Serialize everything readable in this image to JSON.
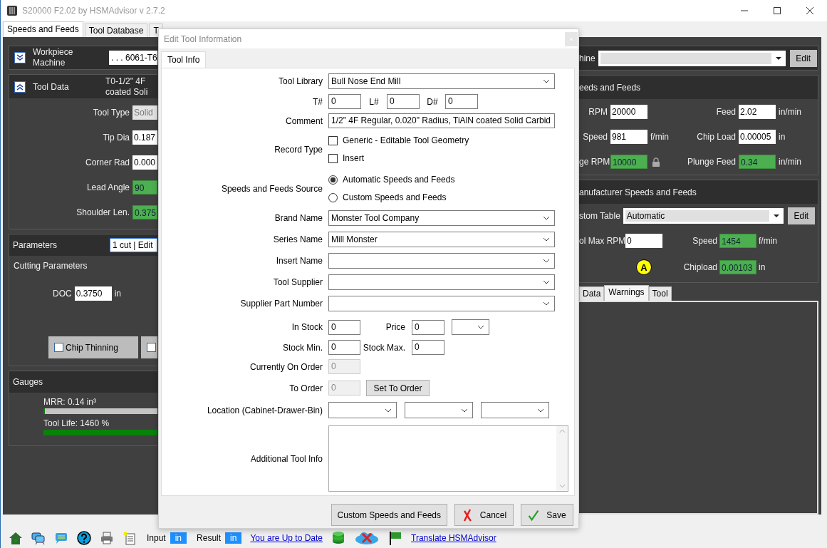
{
  "window": {
    "title": "S20000 F2.02 by HSMAdvisor v 2.7.2"
  },
  "main_tabs": [
    {
      "label": "Speeds and Feeds",
      "selected": true
    },
    {
      "label": "Tool Database",
      "selected": false
    },
    {
      "label": "T",
      "selected": false
    }
  ],
  "workpiece": {
    "label_lines": [
      "Workpiece",
      "Machine"
    ],
    "value": ". . . 6061-T6",
    "expanded": false
  },
  "tool_data": {
    "title": "Tool Data",
    "expanded": true,
    "summary": [
      "T0-1/2\" 4F",
      "coated Soli"
    ],
    "fields": [
      {
        "label": "Tool Type",
        "value": "Solid",
        "kind": "select"
      },
      {
        "label": "Tip Dia",
        "value": "0.187",
        "kind": "input"
      },
      {
        "label": "Corner Rad",
        "value": "0.000",
        "kind": "input"
      },
      {
        "label": "Lead Angle",
        "value": "90",
        "kind": "computed"
      },
      {
        "label": "Shoulder Len.",
        "value": "0.375",
        "kind": "computed"
      }
    ]
  },
  "parameters": {
    "title": "Parameters",
    "value": "1 cut | Edit",
    "subtitle": "Cutting Parameters",
    "doc": {
      "label": "DOC",
      "value": "0.3750",
      "unit": "in"
    },
    "options": [
      {
        "label": "Chip Thinning",
        "checked": false
      },
      {
        "checked": false
      }
    ]
  },
  "gauges": {
    "title": "Gauges",
    "items": [
      {
        "label": "MRR: 0.14 in³",
        "level": 0.01
      },
      {
        "label": "Tool Life: 1460 %",
        "level": 1
      }
    ]
  },
  "machine": {
    "label": "hine",
    "button": "Edit"
  },
  "speeds_feeds": {
    "title": "eeds and Feeds",
    "fields": [
      {
        "label": "RPM",
        "value": "20000",
        "kind": "input"
      },
      {
        "label": "Feed",
        "value": "2.02",
        "unit": "in/min",
        "kind": "input"
      },
      {
        "label": "Speed",
        "value": "981",
        "unit": "f/min",
        "kind": "input"
      },
      {
        "label": "Chip Load",
        "value": "0.00005",
        "unit": "in",
        "kind": "input"
      },
      {
        "label": "ge RPM",
        "value": "10000",
        "kind": "computed",
        "locked": true
      },
      {
        "label": "Plunge Feed",
        "value": "0.34",
        "unit": "in/min",
        "kind": "computed"
      }
    ]
  },
  "manufacturer": {
    "title": "anufacturer Speeds and Feeds",
    "table_label": "stom Table",
    "table_value": "Automatic",
    "button": "Edit",
    "max_rpm_label": "ol Max RPM",
    "max_rpm": "0",
    "speed": {
      "label": "Speed",
      "value": "1454",
      "unit": "f/min"
    },
    "badge": "A",
    "chipload": {
      "label": "Chipload",
      "value": "0.00103",
      "unit": "in"
    }
  },
  "bottom_tabs": [
    {
      "label": "Data",
      "selected": false
    },
    {
      "label": "Warnings",
      "selected": true
    },
    {
      "label": "Tool",
      "selected": false
    }
  ],
  "dialog": {
    "title": "Edit Tool Information",
    "tabs": [
      {
        "label": "Tool Info",
        "selected": true
      }
    ],
    "tool_library": {
      "label": "Tool Library",
      "value": "Bull Nose End Mill"
    },
    "numbers": [
      {
        "label": "T#",
        "value": "0"
      },
      {
        "label": "L#",
        "value": "0"
      },
      {
        "label": "D#",
        "value": "0"
      }
    ],
    "comment": {
      "label": "Comment",
      "value": "1/2\" 4F Regular, 0.020\" Radius, TiAlN coated Solid Carbid"
    },
    "record_type": {
      "label": "Record Type",
      "options": [
        {
          "label": "Generic - Editable Tool Geometry",
          "checked": false
        },
        {
          "label": "Insert",
          "checked": false
        }
      ]
    },
    "source": {
      "label": "Speeds and Feeds Source",
      "options": [
        {
          "label": "Automatic Speeds and Feeds",
          "selected": true
        },
        {
          "label": "Custom Speeds and Feeds",
          "selected": false
        }
      ]
    },
    "dropdowns": [
      {
        "label": "Brand Name",
        "value": "Monster Tool Company"
      },
      {
        "label": "Series Name",
        "value": "Mill Monster"
      },
      {
        "label": "Insert Name"
      },
      {
        "label": "Tool Supplier"
      },
      {
        "label": "Supplier Part Number"
      }
    ],
    "in_stock": {
      "label": "In Stock",
      "value": "0"
    },
    "price": {
      "label": "Price",
      "value": "0"
    },
    "stock_min": {
      "label": "Stock Min.",
      "value": "0"
    },
    "stock_max": {
      "label": "Stock Max.",
      "value": "0"
    },
    "on_order": {
      "label": "Currently On Order",
      "value": "0",
      "disabled": true
    },
    "to_order": {
      "label": "To Order",
      "value": "0",
      "disabled": true,
      "button": "Set To Order"
    },
    "location": {
      "label": "Location (Cabinet-Drawer-Bin)"
    },
    "additional": {
      "label": "Additional Tool Info"
    },
    "buttons": [
      {
        "label": "Custom Speeds and Feeds",
        "kind": "plain"
      },
      {
        "label": "Cancel",
        "kind": "cancel"
      },
      {
        "label": "Save",
        "kind": "save"
      }
    ]
  },
  "status_bar": {
    "input_label": "Input",
    "input_unit": "in",
    "result_label": "Result",
    "result_unit": "in",
    "update_link": "You are Up to Date",
    "translate_link": "Translate HSMAdvisor"
  }
}
